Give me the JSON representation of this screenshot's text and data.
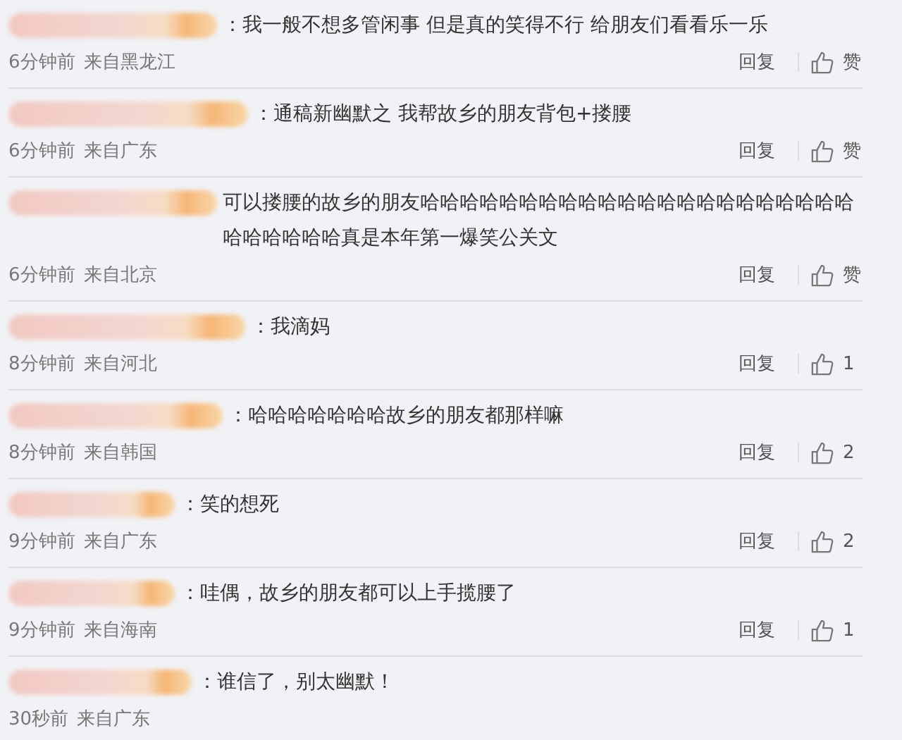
{
  "comments": [
    {
      "text": "：我一般不想多管闲事 但是真的笑得不行 给朋友们看看乐一乐",
      "time": "6分钟前",
      "source": "来自黑龙江",
      "reply": "回复",
      "likes": "赞"
    },
    {
      "text": "：通稿新幽默之 我帮故乡的朋友背包+搂腰",
      "time": "6分钟前",
      "source": "来自广东",
      "reply": "回复",
      "likes": "赞"
    },
    {
      "text": "可以搂腰的故乡的朋友哈哈哈哈哈哈哈哈哈哈哈哈哈哈哈哈哈哈哈哈哈哈哈哈哈哈哈哈真是本年第一爆笑公关文",
      "time": "6分钟前",
      "source": "来自北京",
      "reply": "回复",
      "likes": "赞"
    },
    {
      "text": "：我滴妈",
      "time": "8分钟前",
      "source": "来自河北",
      "reply": "回复",
      "likes": "1"
    },
    {
      "text": "：哈哈哈哈哈哈哈故乡的朋友都那样嘛",
      "time": "8分钟前",
      "source": "来自韩国",
      "reply": "回复",
      "likes": "2"
    },
    {
      "text": "：笑的想死",
      "time": "9分钟前",
      "source": "来自广东",
      "reply": "回复",
      "likes": "2"
    },
    {
      "text": "：哇偶，故乡的朋友都可以上手揽腰了",
      "time": "9分钟前",
      "source": "来自海南",
      "reply": "回复",
      "likes": "1"
    },
    {
      "text": "：谁信了，别太幽默！",
      "time": "30秒前",
      "source": "来自广东"
    }
  ]
}
